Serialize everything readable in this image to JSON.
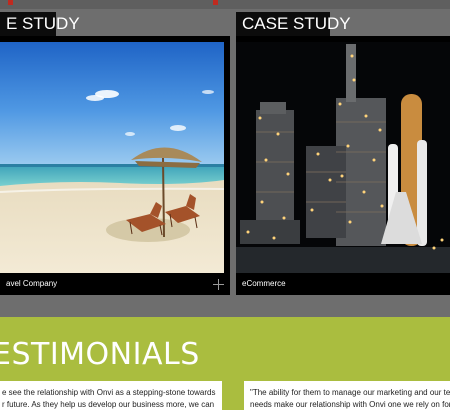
{
  "case_studies": [
    {
      "heading": "E STUDY",
      "caption": "avel Company"
    },
    {
      "heading": "CASE STUDY",
      "caption": "eCommerce"
    }
  ],
  "testimonials": {
    "title": "ESTIMONIALS",
    "quotes": [
      {
        "line1": "e see the relationship with Onvi as a stepping-stone towards",
        "line2": "r future. As they help us develop our business more, we can"
      },
      {
        "line1": "\"The ability for them to manage our marketing and our te",
        "line2": "needs make our relationship with Onvi one we rely on for"
      }
    ]
  },
  "colors": {
    "accent_green": "#aabd3f",
    "card_bg": "#000000",
    "band_gray": "#6e6e6e"
  }
}
